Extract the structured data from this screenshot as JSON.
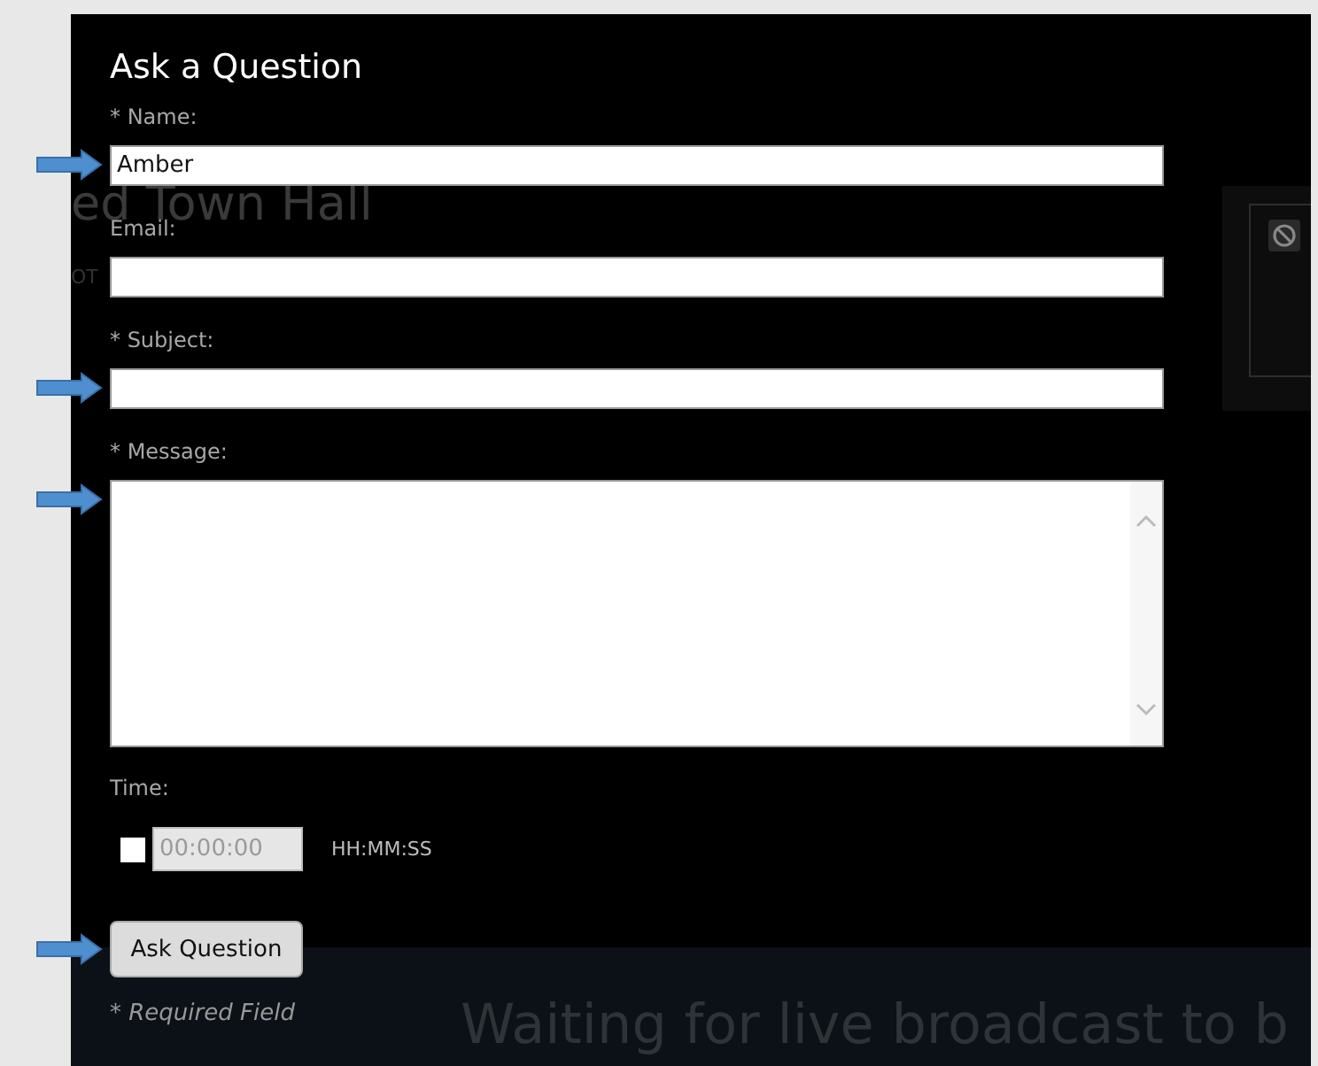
{
  "background": {
    "title_fragment": "ed Town Hall",
    "subtitle_fragment": "OT",
    "banner": "Waiting for live broadcast to b"
  },
  "dialog": {
    "title": "Ask a Question",
    "fields": [
      {
        "kind": "input",
        "label": "* Name:",
        "value": "Amber",
        "annotated": true
      },
      {
        "kind": "input",
        "label": "Email:",
        "annotated": false
      },
      {
        "kind": "input",
        "label": "* Subject:",
        "annotated": true
      },
      {
        "kind": "textarea",
        "label": "* Message:",
        "annotated": true
      }
    ],
    "time": {
      "label": "Time:",
      "checked": false,
      "value": "00:00:00",
      "disabled": true,
      "format": "HH:MM:SS"
    },
    "submit": {
      "label": "Ask Question",
      "annotated": true
    },
    "required_note": "* Required Field"
  }
}
